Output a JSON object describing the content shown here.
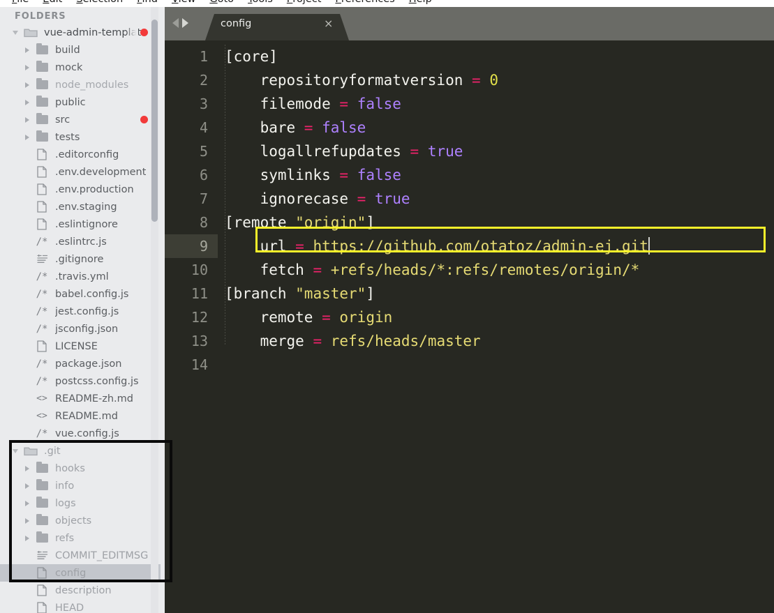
{
  "menubar": {
    "items": [
      "File",
      "Edit",
      "Selection",
      "Find",
      "View",
      "Goto",
      "Tools",
      "Project",
      "Preferences",
      "Help"
    ]
  },
  "sidebar": {
    "header": "FOLDERS",
    "scrollbar": "sidebar-scrollbar",
    "tree": [
      {
        "label": "vue-admin-template",
        "icon": "folder-open-icon",
        "state": "open",
        "indent": 0,
        "kind": "folder",
        "dot": true,
        "dim": "root",
        "truncated": true
      },
      {
        "label": "build",
        "icon": "folder-icon",
        "state": "closed",
        "indent": 1,
        "kind": "folder",
        "dot": false,
        "dim": "normal"
      },
      {
        "label": "mock",
        "icon": "folder-icon",
        "state": "closed",
        "indent": 1,
        "kind": "folder",
        "dot": false,
        "dim": "normal"
      },
      {
        "label": "node_modules",
        "icon": "folder-icon",
        "state": "closed",
        "indent": 1,
        "kind": "folder",
        "dot": false,
        "dim": "dim"
      },
      {
        "label": "public",
        "icon": "folder-icon",
        "state": "closed",
        "indent": 1,
        "kind": "folder",
        "dot": false,
        "dim": "normal"
      },
      {
        "label": "src",
        "icon": "folder-icon",
        "state": "closed",
        "indent": 1,
        "kind": "folder",
        "dot": true,
        "dim": "normal"
      },
      {
        "label": "tests",
        "icon": "folder-icon",
        "state": "closed",
        "indent": 1,
        "kind": "folder",
        "dot": false,
        "dim": "normal"
      },
      {
        "label": ".editorconfig",
        "icon": "file-icon",
        "state": "none",
        "indent": 1,
        "kind": "file",
        "dot": false,
        "dim": "normal"
      },
      {
        "label": ".env.development",
        "icon": "file-icon",
        "state": "none",
        "indent": 1,
        "kind": "file",
        "dot": false,
        "dim": "normal"
      },
      {
        "label": ".env.production",
        "icon": "file-icon",
        "state": "none",
        "indent": 1,
        "kind": "file",
        "dot": false,
        "dim": "normal"
      },
      {
        "label": ".env.staging",
        "icon": "file-icon",
        "state": "none",
        "indent": 1,
        "kind": "file",
        "dot": false,
        "dim": "normal"
      },
      {
        "label": ".eslintignore",
        "icon": "file-icon",
        "state": "none",
        "indent": 1,
        "kind": "file",
        "dot": false,
        "dim": "normal"
      },
      {
        "label": ".eslintrc.js",
        "icon": "js-comment-icon",
        "state": "none",
        "indent": 1,
        "kind": "file",
        "dot": false,
        "dim": "normal"
      },
      {
        "label": ".gitignore",
        "icon": "text-lines-icon",
        "state": "none",
        "indent": 1,
        "kind": "file",
        "dot": false,
        "dim": "normal"
      },
      {
        "label": ".travis.yml",
        "icon": "js-comment-icon",
        "state": "none",
        "indent": 1,
        "kind": "file",
        "dot": false,
        "dim": "normal"
      },
      {
        "label": "babel.config.js",
        "icon": "js-comment-icon",
        "state": "none",
        "indent": 1,
        "kind": "file",
        "dot": false,
        "dim": "normal"
      },
      {
        "label": "jest.config.js",
        "icon": "js-comment-icon",
        "state": "none",
        "indent": 1,
        "kind": "file",
        "dot": false,
        "dim": "normal"
      },
      {
        "label": "jsconfig.json",
        "icon": "js-comment-icon",
        "state": "none",
        "indent": 1,
        "kind": "file",
        "dot": false,
        "dim": "normal"
      },
      {
        "label": "LICENSE",
        "icon": "file-icon",
        "state": "none",
        "indent": 1,
        "kind": "file",
        "dot": false,
        "dim": "normal"
      },
      {
        "label": "package.json",
        "icon": "js-comment-icon",
        "state": "none",
        "indent": 1,
        "kind": "file",
        "dot": false,
        "dim": "normal"
      },
      {
        "label": "postcss.config.js",
        "icon": "js-comment-icon",
        "state": "none",
        "indent": 1,
        "kind": "file",
        "dot": false,
        "dim": "normal"
      },
      {
        "label": "README-zh.md",
        "icon": "markup-icon",
        "state": "none",
        "indent": 1,
        "kind": "file",
        "dot": false,
        "dim": "normal"
      },
      {
        "label": "README.md",
        "icon": "markup-icon",
        "state": "none",
        "indent": 1,
        "kind": "file",
        "dot": false,
        "dim": "normal"
      },
      {
        "label": "vue.config.js",
        "icon": "js-comment-icon",
        "state": "none",
        "indent": 1,
        "kind": "file",
        "dot": false,
        "dim": "normal"
      },
      {
        "label": ".git",
        "icon": "folder-open-icon",
        "state": "open",
        "indent": 0,
        "kind": "folder",
        "dot": false,
        "dim": "dim2"
      },
      {
        "label": "hooks",
        "icon": "folder-icon",
        "state": "closed",
        "indent": 1,
        "kind": "folder",
        "dot": false,
        "dim": "dim2"
      },
      {
        "label": "info",
        "icon": "folder-icon",
        "state": "closed",
        "indent": 1,
        "kind": "folder",
        "dot": false,
        "dim": "dim2"
      },
      {
        "label": "logs",
        "icon": "folder-icon",
        "state": "closed",
        "indent": 1,
        "kind": "folder",
        "dot": false,
        "dim": "dim2"
      },
      {
        "label": "objects",
        "icon": "folder-icon",
        "state": "closed",
        "indent": 1,
        "kind": "folder",
        "dot": false,
        "dim": "dim2"
      },
      {
        "label": "refs",
        "icon": "folder-icon",
        "state": "closed",
        "indent": 1,
        "kind": "folder",
        "dot": false,
        "dim": "dim2"
      },
      {
        "label": "COMMIT_EDITMSG",
        "icon": "text-lines-icon",
        "state": "none",
        "indent": 1,
        "kind": "file",
        "dot": false,
        "dim": "dim2"
      },
      {
        "label": "config",
        "icon": "file-icon",
        "state": "none",
        "indent": 1,
        "kind": "file",
        "dot": false,
        "dim": "dim2",
        "selected": true
      },
      {
        "label": "description",
        "icon": "file-icon",
        "state": "none",
        "indent": 1,
        "kind": "file",
        "dot": false,
        "dim": "dim2"
      },
      {
        "label": "HEAD",
        "icon": "file-icon",
        "state": "none",
        "indent": 1,
        "kind": "file",
        "dot": false,
        "dim": "dim2"
      }
    ]
  },
  "editor": {
    "nav_back": "back-arrow",
    "nav_forward": "forward-arrow",
    "tab": {
      "title": "config",
      "close": "×"
    },
    "line_numbers": [
      "1",
      "2",
      "3",
      "4",
      "5",
      "6",
      "7",
      "8",
      "9",
      "10",
      "11",
      "12",
      "13",
      "14"
    ],
    "active_line": 9,
    "lines": [
      {
        "n": 1,
        "tokens": [
          {
            "t": "[core]",
            "c": "sect"
          }
        ]
      },
      {
        "n": 2,
        "tokens": [
          {
            "t": "    repositoryformatversion ",
            "c": "key"
          },
          {
            "t": "=",
            "c": "eq"
          },
          {
            "t": " ",
            "c": "key"
          },
          {
            "t": "0",
            "c": "num"
          }
        ]
      },
      {
        "n": 3,
        "tokens": [
          {
            "t": "    filemode ",
            "c": "key"
          },
          {
            "t": "=",
            "c": "eq"
          },
          {
            "t": " ",
            "c": "key"
          },
          {
            "t": "false",
            "c": "val"
          }
        ]
      },
      {
        "n": 4,
        "tokens": [
          {
            "t": "    bare ",
            "c": "key"
          },
          {
            "t": "=",
            "c": "eq"
          },
          {
            "t": " ",
            "c": "key"
          },
          {
            "t": "false",
            "c": "val"
          }
        ]
      },
      {
        "n": 5,
        "tokens": [
          {
            "t": "    logallrefupdates ",
            "c": "key"
          },
          {
            "t": "=",
            "c": "eq"
          },
          {
            "t": " ",
            "c": "key"
          },
          {
            "t": "true",
            "c": "val"
          }
        ]
      },
      {
        "n": 6,
        "tokens": [
          {
            "t": "    symlinks ",
            "c": "key"
          },
          {
            "t": "=",
            "c": "eq"
          },
          {
            "t": " ",
            "c": "key"
          },
          {
            "t": "false",
            "c": "val"
          }
        ]
      },
      {
        "n": 7,
        "tokens": [
          {
            "t": "    ignorecase ",
            "c": "key"
          },
          {
            "t": "=",
            "c": "eq"
          },
          {
            "t": " ",
            "c": "key"
          },
          {
            "t": "true",
            "c": "val"
          }
        ]
      },
      {
        "n": 8,
        "tokens": [
          {
            "t": "[remote ",
            "c": "sect"
          },
          {
            "t": "\"origin\"",
            "c": "str"
          },
          {
            "t": "]",
            "c": "sect"
          }
        ]
      },
      {
        "n": 9,
        "tokens": [
          {
            "t": "    url ",
            "c": "key"
          },
          {
            "t": "=",
            "c": "eq"
          },
          {
            "t": " ",
            "c": "key"
          },
          {
            "t": "https://github.com/otatoz/admin-ej.git",
            "c": "str"
          }
        ],
        "caret": true
      },
      {
        "n": 10,
        "tokens": [
          {
            "t": "    fetch ",
            "c": "key"
          },
          {
            "t": "=",
            "c": "eq"
          },
          {
            "t": " ",
            "c": "key"
          },
          {
            "t": "+refs/heads/*:refs/remotes/origin/*",
            "c": "str"
          }
        ]
      },
      {
        "n": 11,
        "tokens": [
          {
            "t": "[branch ",
            "c": "sect"
          },
          {
            "t": "\"master\"",
            "c": "str"
          },
          {
            "t": "]",
            "c": "sect"
          }
        ]
      },
      {
        "n": 12,
        "tokens": [
          {
            "t": "    remote ",
            "c": "key"
          },
          {
            "t": "=",
            "c": "eq"
          },
          {
            "t": " ",
            "c": "key"
          },
          {
            "t": "origin",
            "c": "str"
          }
        ]
      },
      {
        "n": 13,
        "tokens": [
          {
            "t": "    merge ",
            "c": "key"
          },
          {
            "t": "=",
            "c": "eq"
          },
          {
            "t": " ",
            "c": "key"
          },
          {
            "t": "refs/heads/master",
            "c": "str"
          }
        ]
      },
      {
        "n": 14,
        "tokens": []
      }
    ]
  },
  "annotations": [
    {
      "name": "url-line-highlight",
      "color": "#f9f32a",
      "shape": "rectangle"
    },
    {
      "name": "git-folder-highlight",
      "color": "#0a0a0a",
      "shape": "rectangle"
    }
  ],
  "colors": {
    "editor_bg": "#272822",
    "sidebar_bg": "#eaebed",
    "tabbar_bg": "#6a6b66",
    "tab_active_bg": "#34352f",
    "accent_string": "#e6db74",
    "accent_operator": "#f1226c",
    "accent_value": "#ae81ff",
    "modified_dot": "#f23a3a",
    "annotation_yellow": "#f9f32a",
    "annotation_black": "#0a0a0a"
  }
}
